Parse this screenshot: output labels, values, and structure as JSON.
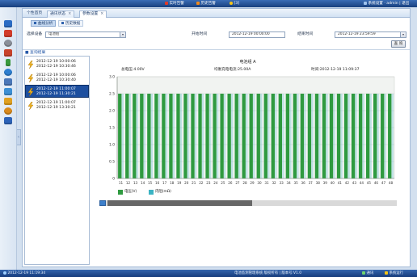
{
  "topbar": {
    "alarm_realtime": "实时告警",
    "alarm_history": "历史告警",
    "alarm_count": "[3]",
    "user_menu": "系统设置 · admin | 退出",
    "colors": {
      "alarm_red": "#e03a2a",
      "alarm_orange": "#f08a1c",
      "alarm_yellow": "#f5c518"
    }
  },
  "sidebar": {
    "icons": [
      "home-icon",
      "alarm-icon",
      "clock-icon",
      "device-icon",
      "battery-icon",
      "user-icon",
      "chart-icon",
      "report-icon",
      "tool-icon",
      "settings-icon",
      "help-icon"
    ],
    "colors": [
      "#2b6cc4",
      "#d23b2a",
      "#8a8f99",
      "#c8432b",
      "#3a9a3e",
      "#2e7fd0",
      "#4a77b8",
      "#3c8fd4",
      "#e0a020",
      "#d98a1c",
      "#2d63b8"
    ],
    "collapse_glyph": "‹"
  },
  "tabs": [
    {
      "label": "个性首页"
    },
    {
      "label": "通讯状态",
      "close": "×"
    },
    {
      "label": "参数设置",
      "close": "×"
    }
  ],
  "subtabs": [
    {
      "label": "曲线分析"
    },
    {
      "label": "历史数据"
    }
  ],
  "query": {
    "device_label": "选择设备",
    "device_value": "电池组",
    "start_label": "开始时间",
    "start_value": "2012-12-19 00:00:00",
    "end_label": "结束时间",
    "end_value": "2012-12-19 23:59:59",
    "dropdown_glyph": "▾",
    "search_button": "查 询"
  },
  "results": {
    "header": "■ 查询结果",
    "items": [
      {
        "start": "2012-12-19 10:00:06",
        "end": "2012-12-19 10:30:46"
      },
      {
        "start": "2012-12-19 10:00:06",
        "end": "2012-12-19 10:30:40"
      },
      {
        "start": "2012-12-19 11:00:07",
        "end": "2012-12-19 11:30:21"
      },
      {
        "start": "2012-12-19 11:00:07",
        "end": "2012-12-19 13:30:21"
      }
    ],
    "selected_index": 2,
    "colors": {
      "selected_bg": "#1d4f9f",
      "icon": "#f2b51d"
    }
  },
  "chart_data": {
    "type": "bar",
    "title": "电池组 A",
    "annotations": [
      "总电压:4.00V",
      "均衡充电电流:25.00A",
      "时间:2012-12-19 11:09:37"
    ],
    "categories": [
      "11",
      "12",
      "13",
      "14",
      "15",
      "16",
      "17",
      "18",
      "19",
      "20",
      "21",
      "22",
      "23",
      "24",
      "25",
      "26",
      "27",
      "28",
      "29",
      "30",
      "31",
      "32",
      "33",
      "34",
      "35",
      "36",
      "37",
      "38",
      "39",
      "40",
      "41",
      "42",
      "43",
      "44",
      "45",
      "46",
      "47",
      "48"
    ],
    "series": [
      {
        "name": "电压(V)",
        "color": "#2f9a40",
        "values": [
          2.5,
          2.5,
          2.5,
          2.5,
          2.5,
          2.5,
          2.5,
          2.5,
          2.5,
          2.5,
          2.5,
          2.5,
          2.5,
          2.5,
          2.5,
          2.5,
          2.5,
          2.5,
          2.5,
          2.5,
          2.5,
          2.5,
          2.5,
          2.5,
          2.5,
          2.5,
          2.5,
          2.5,
          2.5,
          2.5,
          2.5,
          2.5,
          2.5,
          2.5,
          2.5,
          2.5,
          2.5,
          2.5
        ]
      },
      {
        "name": "内阻(mΩ)",
        "color": "#3bb3c3",
        "values": [
          2.5,
          2.5,
          2.5,
          2.5,
          2.5,
          2.5,
          2.5,
          2.5,
          2.5,
          2.5,
          2.5,
          2.5,
          2.5,
          2.5,
          2.5,
          2.5,
          2.5,
          2.5,
          2.5,
          2.5,
          2.5,
          2.5,
          2.5,
          2.5,
          2.5,
          2.5,
          2.5,
          2.5,
          2.5,
          2.5,
          2.5,
          2.5,
          2.5,
          2.5,
          2.5,
          2.5,
          2.5,
          2.5
        ]
      }
    ],
    "xlabel": "",
    "ylabel": "",
    "ylim": [
      0,
      3
    ],
    "yticks": [
      0,
      0.5,
      1,
      1.5,
      2,
      2.5,
      3
    ],
    "ytick_labels": [
      "0",
      "0.5",
      "1.0",
      "1.5",
      "2.0",
      "2.5",
      "3.0"
    ],
    "grid": true,
    "legend": "bottom-left"
  },
  "scrollbar": {
    "position": 0,
    "visible_fraction": 0.5
  },
  "statusbar": {
    "time": "2012-12-19 11:19:34",
    "center": "电池监测管理系统 版权所有 | 版本号:V1.0",
    "right_comm": "通讯",
    "right_status": "系统运行"
  }
}
